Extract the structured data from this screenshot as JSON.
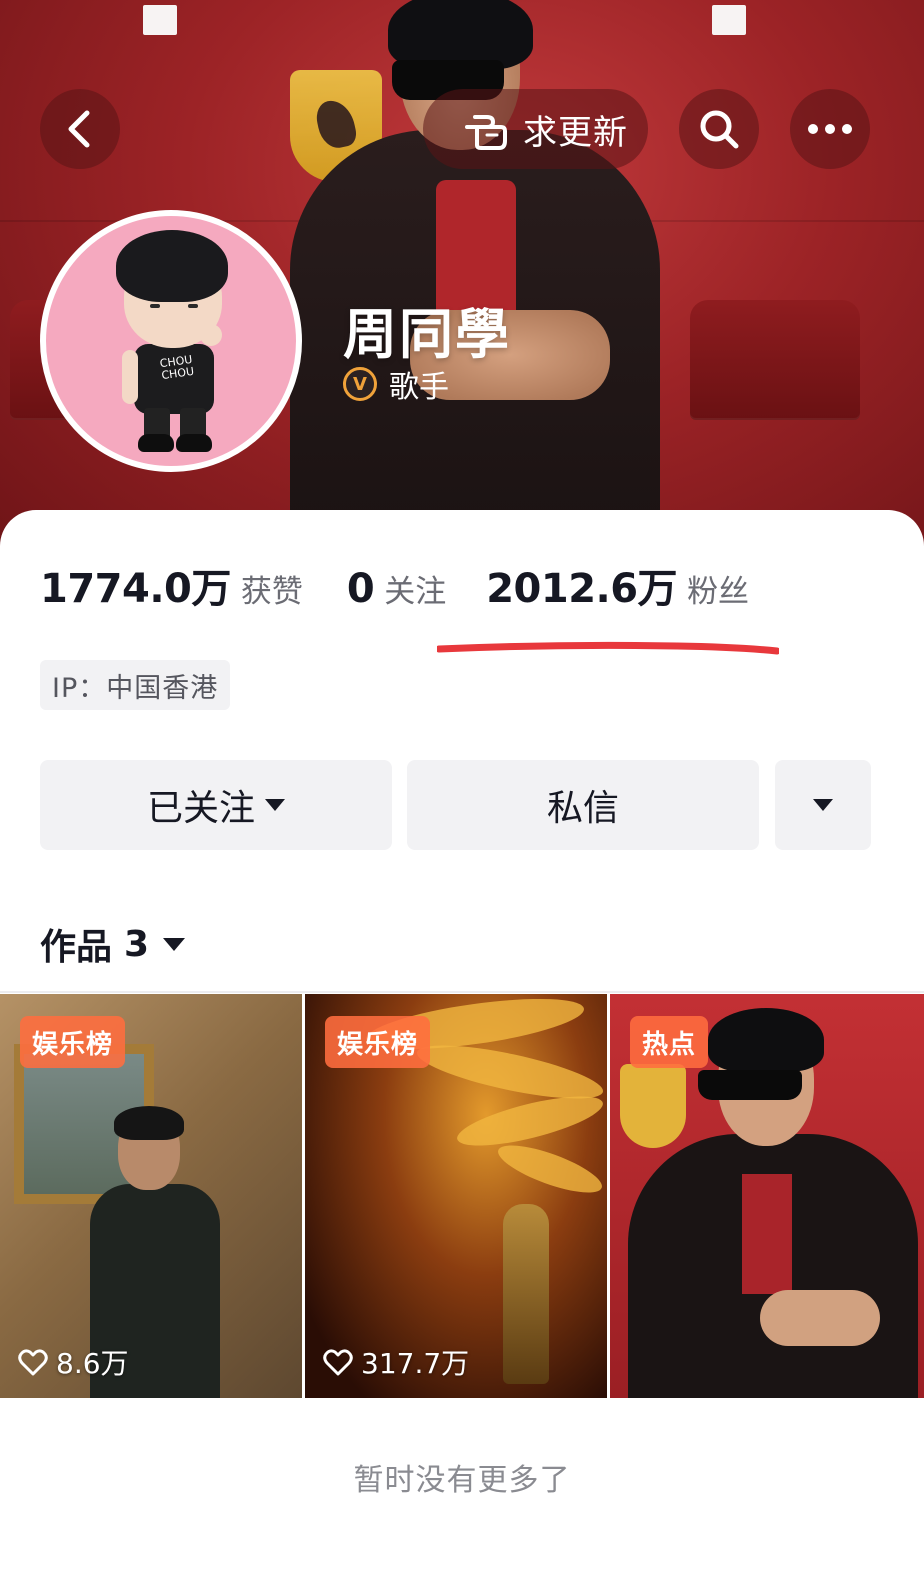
{
  "header": {
    "update_button_label": "求更新",
    "back_icon": "chevron-left-icon",
    "search_icon": "search-icon",
    "more_icon": "more-dots-icon",
    "update_icon": "pointing-hand-icon"
  },
  "profile": {
    "name": "周同學",
    "verify_badge": "V",
    "verify_label": "歌手",
    "ip": "IP：中国香港"
  },
  "stats": {
    "likes_value": "1774.0万",
    "likes_label": "获赞",
    "following_value": "0",
    "following_label": "关注",
    "fans_value": "2012.6万",
    "fans_label": "粉丝"
  },
  "actions": {
    "follow_label": "已关注",
    "message_label": "私信"
  },
  "works": {
    "tab_label": "作品",
    "count": "3",
    "items": [
      {
        "badge": "娱乐榜",
        "likes": "8.6万"
      },
      {
        "badge": "娱乐榜",
        "likes": "317.7万"
      },
      {
        "badge": "热点",
        "likes": ""
      }
    ]
  },
  "footer": {
    "note": "暂时没有更多了"
  },
  "colors": {
    "banner_red": "#9c2326",
    "badge_orange": "#ff6d3f",
    "verify_gold": "#f0a23a",
    "annotation_red": "#e8383c"
  }
}
